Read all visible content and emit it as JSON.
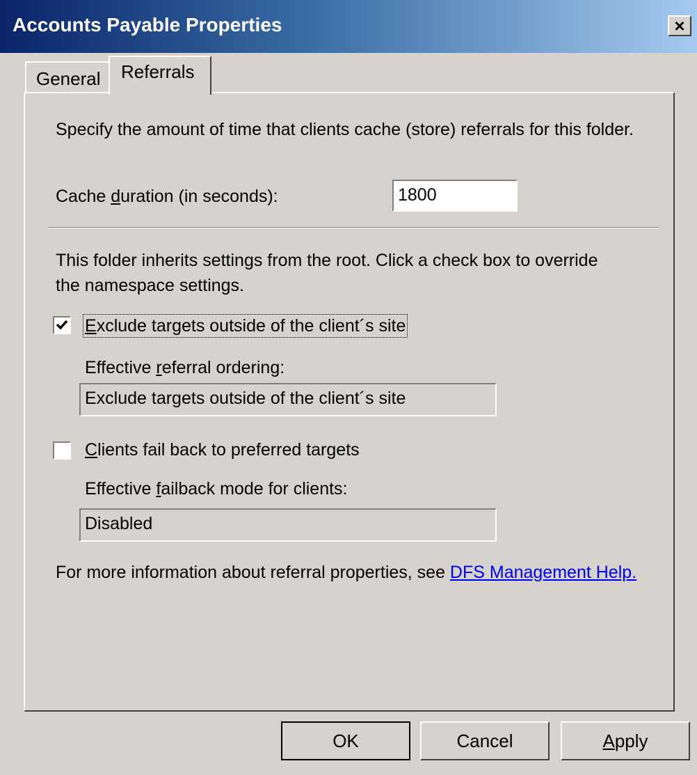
{
  "window": {
    "title": "Accounts Payable Properties",
    "close_glyph": "×"
  },
  "tabs": [
    {
      "label": "General",
      "selected": false
    },
    {
      "label": "Referrals",
      "selected": true
    }
  ],
  "referrals": {
    "cache_description": "Specify the amount of time that clients cache (store) referrals for this folder.",
    "cache_label_pre": "Cache ",
    "cache_label_access": "d",
    "cache_label_post": "uration (in seconds):",
    "cache_value": "1800",
    "inherit_text": "This folder inherits settings from the root. Click a check box to override the namespace settings.",
    "exclude_checkbox": {
      "checked": true,
      "label_access": "E",
      "label_rest": "xclude targets outside of the client´s site"
    },
    "ordering_label_pre": "Effective ",
    "ordering_label_access": "r",
    "ordering_label_post": "eferral ordering:",
    "ordering_value": "Exclude targets outside of the client´s site",
    "failback_checkbox": {
      "checked": false,
      "label_access": "C",
      "label_rest": "lients fail back to preferred targets"
    },
    "failback_label_pre": "Effective ",
    "failback_label_access": "f",
    "failback_label_post": "ailback mode for clients:",
    "failback_value": "Disabled",
    "help_text": "For more information about referral properties, see ",
    "help_link": "DFS Management Help."
  },
  "buttons": {
    "ok": "OK",
    "cancel": "Cancel",
    "apply_access": "A",
    "apply_rest": "pply"
  },
  "icons": {
    "close": "close-icon",
    "check": "checkmark-icon"
  },
  "colors": {
    "dialog_bg": "#d6d3ce",
    "titlebar_start": "#0a246a",
    "titlebar_end": "#a6caf0",
    "link": "#0000ee"
  }
}
